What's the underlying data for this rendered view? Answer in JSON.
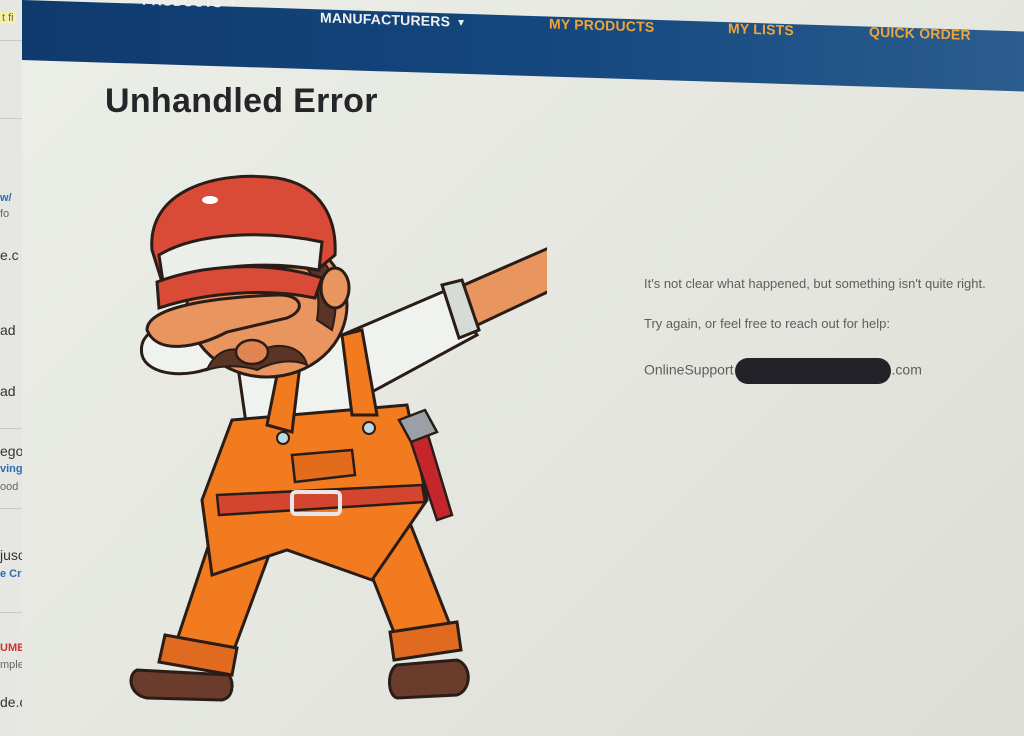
{
  "background_window": {
    "fragments": [
      "t fi",
      "w/",
      "fo",
      "e.c",
      "ad",
      "ad",
      "ego",
      "ving",
      "ood",
      "jusc",
      "e Cr",
      "UMB",
      "mple",
      "de.c"
    ]
  },
  "nav": {
    "items": [
      {
        "label": "PRODUCTS",
        "has_dropdown": true
      },
      {
        "label": "MANUFACTURERS",
        "has_dropdown": true
      },
      {
        "label": "MY PRODUCTS",
        "has_dropdown": false
      },
      {
        "label": "MY LISTS",
        "has_dropdown": false
      },
      {
        "label": "QUICK ORDER",
        "has_dropdown": false
      }
    ],
    "colors": {
      "bar": "#14487f",
      "primary_text": "#f1f1f1",
      "accent_text": "#f0a536"
    }
  },
  "main": {
    "title": "Unhandled Error",
    "message_1": "It's not clear what happened, but something isn't quite right.",
    "message_2": "Try again, or feel free to reach out for help:",
    "email_prefix": "OnlineSupport",
    "email_suffix": ".com",
    "illustration": "dabbing-plumber-illustration"
  }
}
